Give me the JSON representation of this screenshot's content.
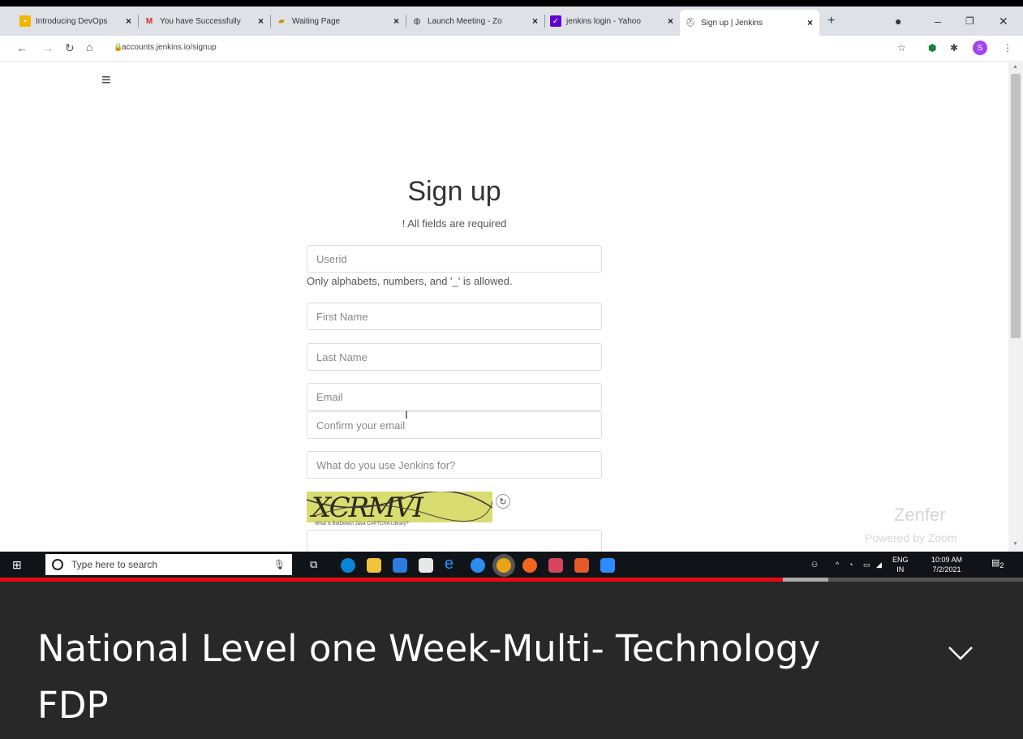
{
  "browser": {
    "tabs": [
      {
        "label": "Introducing DevOps",
        "icon": "slides-icon",
        "color": "#f4b400"
      },
      {
        "label": "You have Successfully",
        "icon": "gmail-icon",
        "color": "#d93025"
      },
      {
        "label": "Waiting Page",
        "icon": "folder-icon",
        "color": "#e0a800"
      },
      {
        "label": "Launch Meeting - Zo",
        "icon": "globe-icon",
        "color": "#333333"
      },
      {
        "label": "jenkins login - Yahoo",
        "icon": "yahoo-icon",
        "color": "#5f01d1"
      },
      {
        "label": "Sign up | Jenkins",
        "icon": "jenkins-icon",
        "color": "#555555",
        "active": true
      }
    ],
    "url": "accounts.jenkins.io/signup",
    "profile_initial": "S"
  },
  "page": {
    "title": "Sign up",
    "subtitle": "! All fields are required",
    "fields": {
      "userid": "Userid",
      "userid_hint": "Only alphabets, numbers, and '_' is allowed.",
      "first_name": "First Name",
      "last_name": "Last Name",
      "email": "Email",
      "confirm_email": "Confirm your email",
      "usage": "What do you use Jenkins for?"
    },
    "captcha_text": "XCRMVI",
    "captcha_link": "What is BotDetect Java CAPTCHA Library?"
  },
  "watermarks": {
    "brand": "Zenfer",
    "powered": "Powered by Zoom"
  },
  "taskbar": {
    "search_placeholder": "Type here to search",
    "lang_top": "ENG",
    "lang_bottom": "IN",
    "time": "10:09 AM",
    "date": "7/2/2021",
    "notification_count": "2"
  },
  "video": {
    "title": "National Level one Week-Multi- Technology FDP",
    "progress": 0.765,
    "buffered": 0.81
  }
}
